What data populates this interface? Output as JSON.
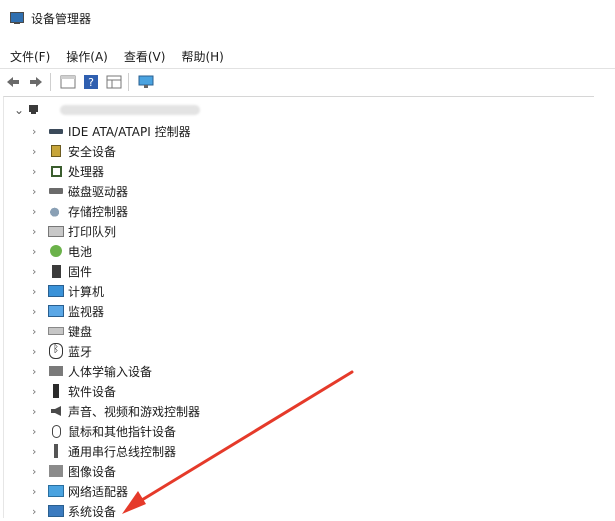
{
  "window": {
    "title": "设备管理器"
  },
  "menu": [
    {
      "label": "文件(F)"
    },
    {
      "label": "操作(A)"
    },
    {
      "label": "查看(V)"
    },
    {
      "label": "帮助(H)"
    }
  ],
  "toolbar": [
    {
      "icon": "back-arrow-icon"
    },
    {
      "icon": "forward-arrow-icon"
    },
    {
      "icon": "properties-icon"
    },
    {
      "icon": "help-icon"
    },
    {
      "icon": "grid-icon"
    },
    {
      "icon": "monitor-icon"
    }
  ],
  "tree": {
    "root_label": "",
    "items": [
      {
        "label": "IDE ATA/ATAPI 控制器",
        "icon": "ide-controller-icon"
      },
      {
        "label": "安全设备",
        "icon": "security-device-icon"
      },
      {
        "label": "处理器",
        "icon": "processor-icon"
      },
      {
        "label": "磁盘驱动器",
        "icon": "disk-drive-icon"
      },
      {
        "label": "存储控制器",
        "icon": "storage-controller-icon"
      },
      {
        "label": "打印队列",
        "icon": "print-queue-icon"
      },
      {
        "label": "电池",
        "icon": "battery-icon"
      },
      {
        "label": "固件",
        "icon": "firmware-icon"
      },
      {
        "label": "计算机",
        "icon": "computer-icon"
      },
      {
        "label": "监视器",
        "icon": "monitor-icon"
      },
      {
        "label": "键盘",
        "icon": "keyboard-icon"
      },
      {
        "label": "蓝牙",
        "icon": "bluetooth-icon"
      },
      {
        "label": "人体学输入设备",
        "icon": "human-interface-device-icon"
      },
      {
        "label": "软件设备",
        "icon": "software-device-icon"
      },
      {
        "label": "声音、视频和游戏控制器",
        "icon": "audio-icon"
      },
      {
        "label": "鼠标和其他指针设备",
        "icon": "mouse-icon"
      },
      {
        "label": "通用串行总线控制器",
        "icon": "usb-icon"
      },
      {
        "label": "图像设备",
        "icon": "imaging-device-icon"
      },
      {
        "label": "网络适配器",
        "icon": "network-adapter-icon"
      },
      {
        "label": "系统设备",
        "icon": "system-device-icon"
      }
    ]
  },
  "annotation": {
    "arrow_color": "#e53a2a"
  }
}
